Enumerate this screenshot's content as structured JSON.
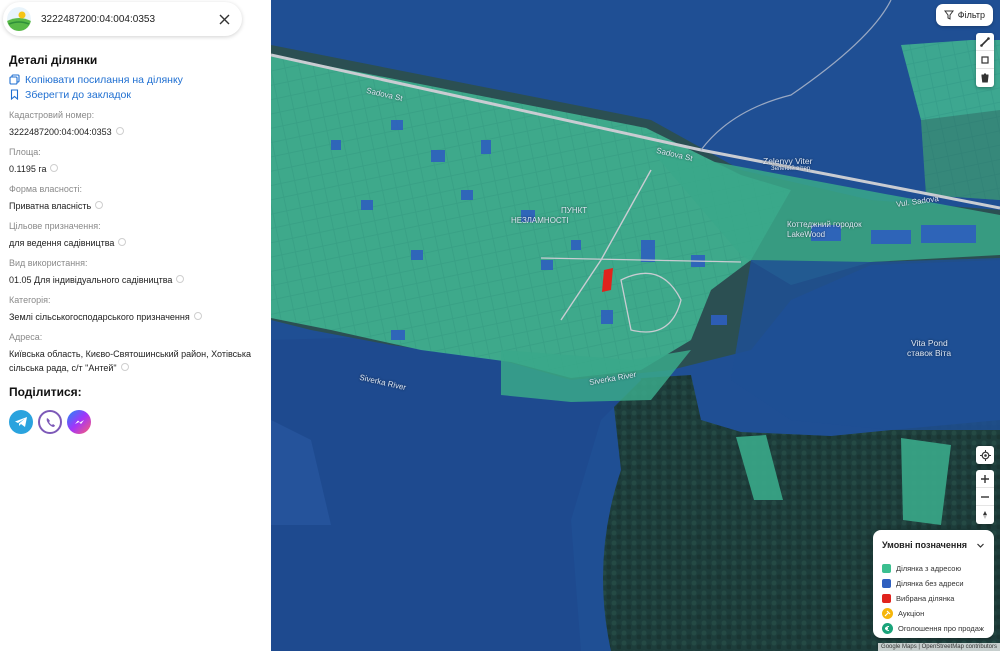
{
  "search": {
    "value": "3222487200:04:004:0353"
  },
  "details": {
    "title": "Деталі ділянки",
    "copy_link": "Копіювати посилання на ділянку",
    "bookmark": "Зберегти до закладок",
    "fields": [
      {
        "label": "Кадастровий номер:",
        "value": "3222487200:04:004:0353"
      },
      {
        "label": "Площа:",
        "value": "0.1195 га"
      },
      {
        "label": "Форма власності:",
        "value": "Приватна власність"
      },
      {
        "label": "Цільове призначення:",
        "value": "для ведення садівництва"
      },
      {
        "label": "Вид використання:",
        "value": "01.05 Для індивідуального садівництва"
      },
      {
        "label": "Категорія:",
        "value": "Землі сільськогосподарського призначення"
      },
      {
        "label": "Адреса:",
        "value": "Київська область, Києво-Святошинський район, Хотівська сільська рада, с/т \"Антей\""
      }
    ],
    "share_title": "Поділитися:"
  },
  "share_icons": [
    "telegram-icon",
    "viber-icon",
    "messenger-icon"
  ],
  "map": {
    "filter_label": "Фільтр",
    "labels": {
      "sadova_st_left": "Sadova St",
      "sadova_st_mid": "Sadova St",
      "vul_sadova": "Vul. Sadova",
      "zelenyy_viter": "Zelenyy Viter",
      "zelenyy_sub": "Зелений вітер",
      "lakewood": "Коттеджний городок LakeWood",
      "punkt": "ПУНКТ",
      "nezlamnosti": "НЕЗЛАМНОСТІ",
      "vita_pond": "Vita Pond",
      "vita_pond_uk": "ставок Віта",
      "siverka_left": "Siverka River",
      "siverka_mid": "Siverka River"
    },
    "attribution": "Google Maps | OpenStreetMap contributors"
  },
  "legend": {
    "title": "Умовні позначення",
    "items": [
      {
        "label": "Ділянка з адресою",
        "color": "#3bbf8f"
      },
      {
        "label": "Ділянка без адреси",
        "color": "#2e5fbf"
      },
      {
        "label": "Вибрана ділянка",
        "color": "#e0231d"
      },
      {
        "label": "Аукціон",
        "icon": "auction-icon",
        "color": "#f5b60b"
      },
      {
        "label": "Оголошення про продаж",
        "icon": "sale-icon",
        "color": "#1aa37a"
      }
    ]
  },
  "colors": {
    "accent": "#1f6fd1",
    "parcel_green": "#3bbf8f",
    "parcel_blue": "#2e5fbf",
    "selected": "#e0231d",
    "water": "#1d4f95"
  }
}
